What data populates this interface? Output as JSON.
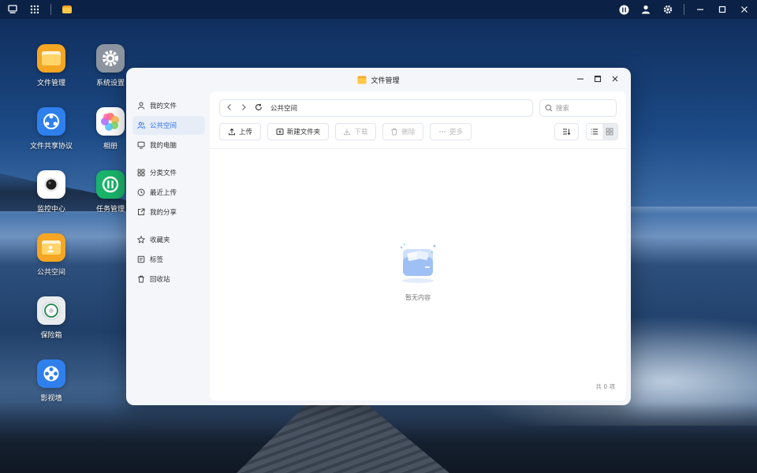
{
  "topbar": {
    "left_icons": [
      "desktop-icon",
      "apps-grid-icon",
      "file-manager-task-icon"
    ],
    "right_icons": [
      "upload-status-icon",
      "user-icon",
      "settings-icon",
      "minimize-icon",
      "maximize-icon",
      "close-icon"
    ]
  },
  "desktop": {
    "icons": [
      {
        "label": "文件管理",
        "icon": "folder-icon",
        "color": "#f5a623"
      },
      {
        "label": "系统设置",
        "icon": "gear-icon",
        "color": "#8c959f"
      },
      {
        "label": "文件共享协议",
        "icon": "share-protocol-icon",
        "color": "#2f80ed"
      },
      {
        "label": "相册",
        "icon": "photos-icon",
        "color": "#ffffff"
      },
      {
        "label": "监控中心",
        "icon": "camera-icon",
        "color": "#ffffff"
      },
      {
        "label": "任务管理",
        "icon": "task-icon",
        "color": "#19b46a"
      },
      {
        "label": "公共空间",
        "icon": "public-space-icon",
        "color": "#f5a623"
      },
      {
        "label": "保险箱",
        "icon": "safe-icon",
        "color": "#e9ecef"
      },
      {
        "label": "影视墙",
        "icon": "film-icon",
        "color": "#2f80ed"
      }
    ]
  },
  "window": {
    "title": "文件管理",
    "sidebar": {
      "group1": [
        "我的文件",
        "公共空间",
        "我的电脑"
      ],
      "group2": [
        "分类文件",
        "最近上传",
        "我的分享"
      ],
      "group3": [
        "收藏夹",
        "标签",
        "回收站"
      ],
      "active": "公共空间"
    },
    "address": "公共空间",
    "search_placeholder": "搜索",
    "toolbar": {
      "upload": "上传",
      "new_folder": "新建文件夹",
      "download": "下载",
      "delete": "删除",
      "more": "更多"
    },
    "empty_text": "暂无内容",
    "item_count": "共 0 项"
  },
  "colors": {
    "accent": "#2f6fe4",
    "folder": "#f5a623",
    "window_bg": "#f4f6fa"
  }
}
